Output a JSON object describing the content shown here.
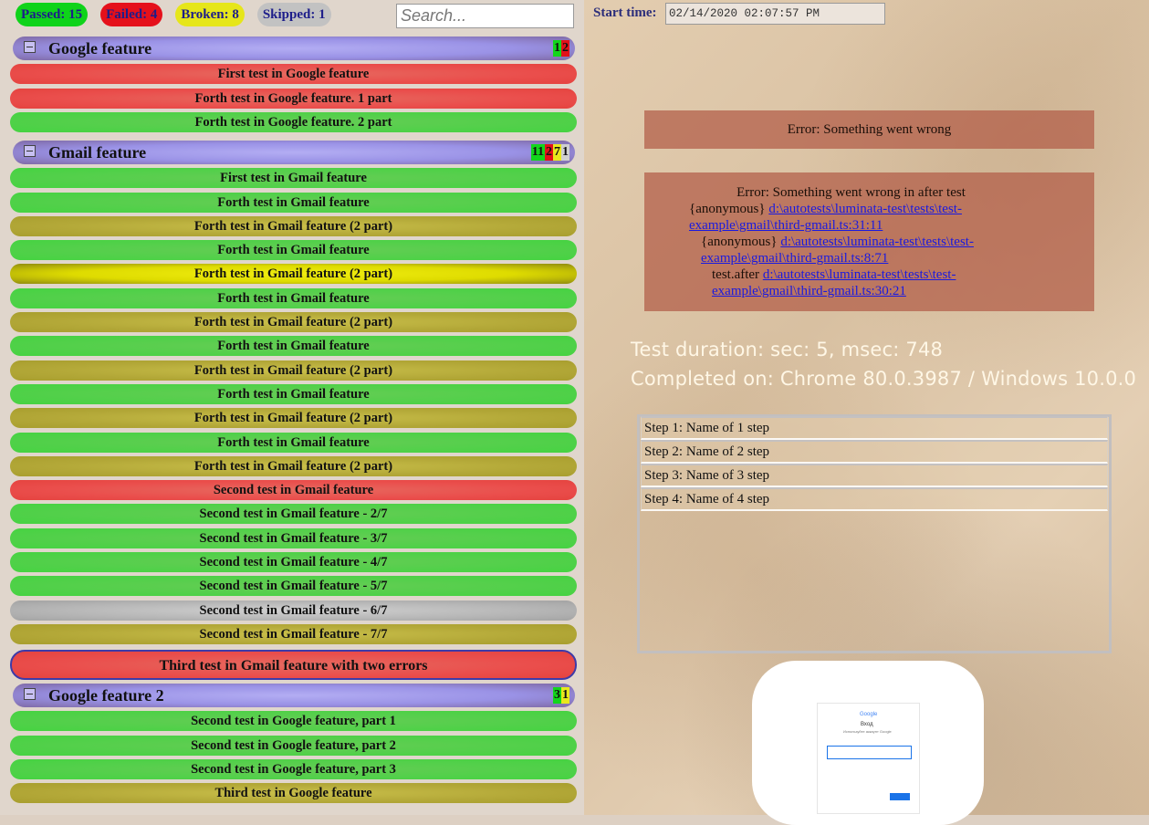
{
  "stats": {
    "passed": "Passed: 15",
    "failed": "Failed: 4",
    "broken": "Broken: 8",
    "skipped": "Skipped: 1"
  },
  "search": {
    "placeholder": "Search..."
  },
  "features": [
    {
      "title": "Google feature",
      "counts": [
        {
          "type": "p",
          "value": "1"
        },
        {
          "type": "f",
          "value": "2"
        }
      ],
      "tests": [
        {
          "name": "First test in Google feature",
          "status": "failed"
        },
        {
          "name": "Forth test in Google feature. 1 part",
          "status": "failed"
        },
        {
          "name": "Forth test in Google feature. 2 part",
          "status": "passed"
        }
      ]
    },
    {
      "title": "Gmail feature",
      "counts": [
        {
          "type": "p",
          "value": "11"
        },
        {
          "type": "f",
          "value": "2"
        },
        {
          "type": "b",
          "value": "7"
        },
        {
          "type": "s",
          "value": "1"
        }
      ],
      "tests": [
        {
          "name": "First test in Gmail feature",
          "status": "passed"
        },
        {
          "name": "Forth test in Gmail feature",
          "status": "passed"
        },
        {
          "name": "Forth test in Gmail feature (2 part)",
          "status": "broken"
        },
        {
          "name": "Forth test in Gmail feature",
          "status": "passed"
        },
        {
          "name": "Forth test in Gmail feature (2 part)",
          "status": "broken-hl"
        },
        {
          "name": "Forth test in Gmail feature",
          "status": "passed"
        },
        {
          "name": "Forth test in Gmail feature (2 part)",
          "status": "broken"
        },
        {
          "name": "Forth test in Gmail feature",
          "status": "passed"
        },
        {
          "name": "Forth test in Gmail feature (2 part)",
          "status": "broken"
        },
        {
          "name": "Forth test in Gmail feature",
          "status": "passed"
        },
        {
          "name": "Forth test in Gmail feature (2 part)",
          "status": "broken"
        },
        {
          "name": "Forth test in Gmail feature",
          "status": "passed"
        },
        {
          "name": "Forth test in Gmail feature (2 part)",
          "status": "broken"
        },
        {
          "name": "Second test in Gmail feature",
          "status": "failed"
        },
        {
          "name": "Second test in Gmail feature - 2/7",
          "status": "passed"
        },
        {
          "name": "Second test in Gmail feature - 3/7",
          "status": "passed"
        },
        {
          "name": "Second test in Gmail feature - 4/7",
          "status": "passed"
        },
        {
          "name": "Second test in Gmail feature - 5/7",
          "status": "passed"
        },
        {
          "name": "Second test in Gmail feature - 6/7",
          "status": "skipped"
        },
        {
          "name": "Second test in Gmail feature - 7/7",
          "status": "broken"
        },
        {
          "name": "Third test in Gmail feature with two errors",
          "status": "failed",
          "selected": true
        }
      ]
    },
    {
      "title": "Google feature 2",
      "counts": [
        {
          "type": "p",
          "value": "3"
        },
        {
          "type": "b",
          "value": "1"
        }
      ],
      "tests": [
        {
          "name": "Second test in Google feature, part 1",
          "status": "passed"
        },
        {
          "name": "Second test in Google feature, part 2",
          "status": "passed"
        },
        {
          "name": "Second test in Google feature, part 3",
          "status": "passed"
        },
        {
          "name": "Third test in Google feature",
          "status": "broken"
        }
      ]
    }
  ],
  "details": {
    "start_label": "Start time:",
    "start_value": "02/14/2020 02:07:57 PM",
    "error1": "Error: Something went wrong",
    "error2_title": "Error: Something went wrong in after test",
    "stack": [
      {
        "prefix": "{anonymous}",
        "link": "d:\\autotests\\luminata-test\\tests\\test-example\\gmail\\third-gmail.ts:31:11"
      },
      {
        "prefix": "{anonymous}",
        "link": "d:\\autotests\\luminata-test\\tests\\test-example\\gmail\\third-gmail.ts:8:71"
      },
      {
        "prefix": "test.after",
        "link": "d:\\autotests\\luminata-test\\tests\\test-example\\gmail\\third-gmail.ts:30:21"
      }
    ],
    "duration": "Test duration: sec: 5, msec: 748",
    "completed": "Completed on: Chrome 80.0.3987 / Windows 10.0.0",
    "steps": [
      "Step 1: Name of 1 step",
      "Step 2: Name of 2 step",
      "Step 3: Name of 3 step",
      "Step 4: Name of 4 step"
    ],
    "screenshot": {
      "brand": "Google",
      "heading": "Вход",
      "subheading": "Используйте аккаунт Google"
    }
  }
}
